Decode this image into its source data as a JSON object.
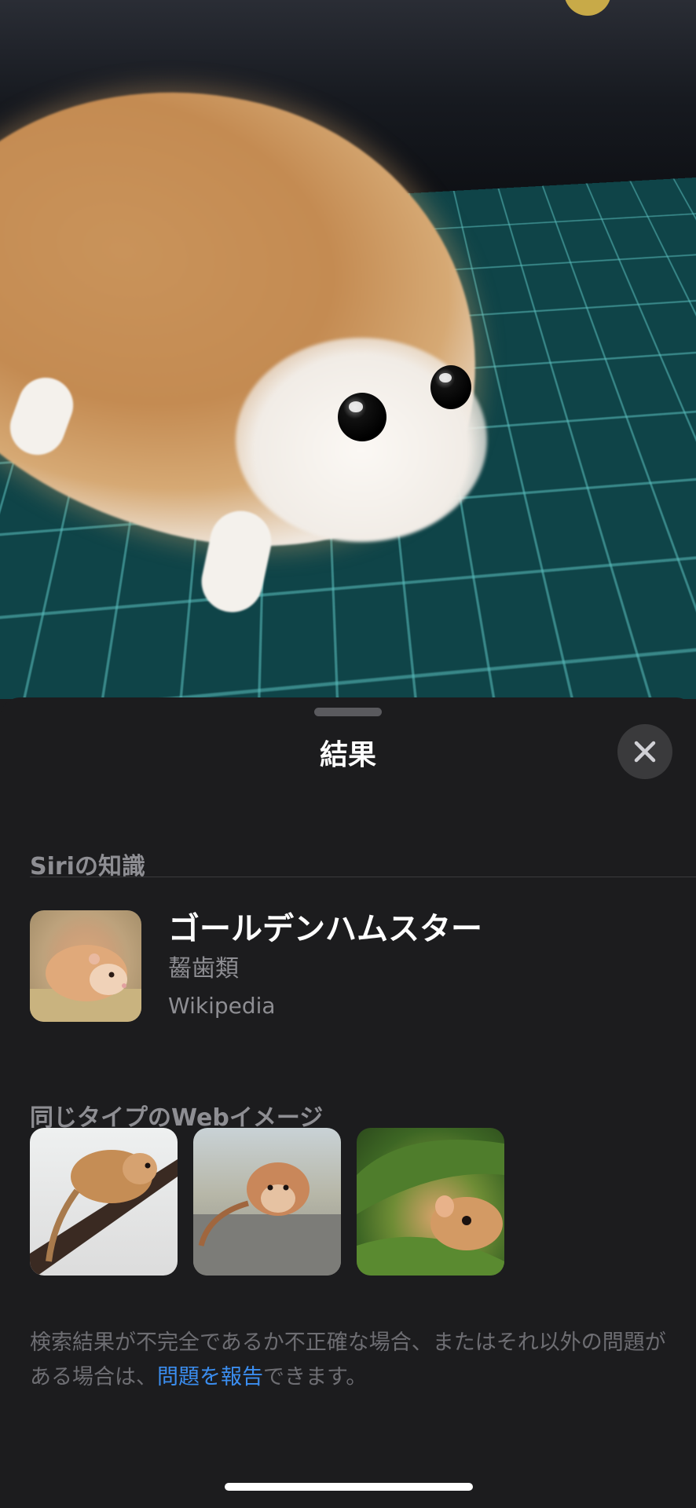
{
  "sheet": {
    "title": "結果",
    "close_icon": "close-icon"
  },
  "siri_knowledge": {
    "heading": "Siriの知識",
    "name": "ゴールデンハムスター",
    "category": "齧歯類",
    "source": "Wikipedia"
  },
  "web_images": {
    "heading": "同じタイプのWebイメージ",
    "count": 3
  },
  "disclaimer": {
    "before": "検索結果が不完全であるか不正確な場合、またはそれ以外の問題がある場合は、",
    "link": "問題を報告",
    "after": "できます。"
  },
  "colors": {
    "sheet_bg": "#1c1c1e",
    "link": "#3b8ef0",
    "secondary_text": "#8e8e93"
  }
}
